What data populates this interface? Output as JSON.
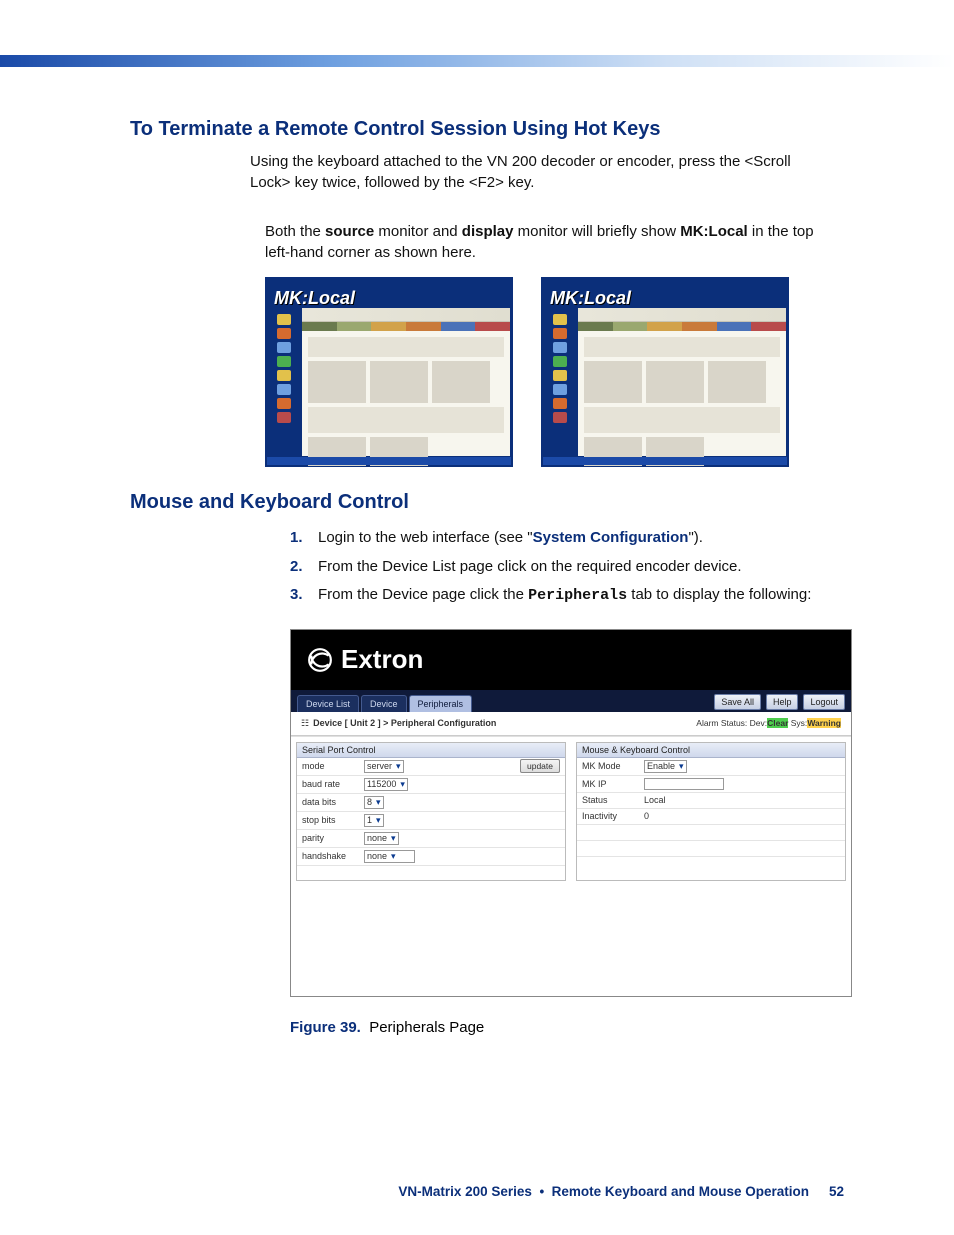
{
  "section1_title": "To Terminate a Remote Control Session Using Hot Keys",
  "section1_body": "Using the keyboard attached to the VN 200 decoder or encoder, press the <Scroll Lock> key twice, followed by the <F2> key.",
  "note_pre": "Both the ",
  "note_source": "source",
  "note_mid1": " monitor and ",
  "note_display": "display",
  "note_mid2": " monitor will briefly show ",
  "note_mklocal": "MK:Local",
  "note_post": " in the top left-hand corner as shown here.",
  "mk_overlay": "MK:Local",
  "section2_title": "Mouse and Keyboard Control",
  "steps": {
    "s1_pre": "Login to the web interface (see \"",
    "s1_link": "System Configuration",
    "s1_post": "\").",
    "s2": "From the Device List page click on the required encoder device.",
    "s3_pre": "From the Device page click the ",
    "s3_tt": "Peripherals",
    "s3_post": " tab to display the following:"
  },
  "app": {
    "brand": "Extron",
    "tabs": {
      "device_list": "Device List",
      "device": "Device",
      "peripherals": "Peripherals"
    },
    "buttons": {
      "save_all": "Save All",
      "help": "Help",
      "logout": "Logout",
      "update": "update"
    },
    "crumb": "Device [ Unit 2 ]  >  Peripheral Configuration",
    "alarm_label": "Alarm Status: Dev:",
    "alarm_dev": "Clear",
    "alarm_mid": "  Sys:",
    "alarm_sys": "Warning",
    "serial": {
      "title": "Serial Port Control",
      "rows": {
        "mode_l": "mode",
        "mode_v": "server",
        "baud_l": "baud rate",
        "baud_v": "115200",
        "data_l": "data bits",
        "data_v": "8",
        "stop_l": "stop bits",
        "stop_v": "1",
        "parity_l": "parity",
        "parity_v": "none",
        "hand_l": "handshake",
        "hand_v": "none"
      }
    },
    "mk": {
      "title": "Mouse & Keyboard Control",
      "rows": {
        "mode_l": "MK Mode",
        "mode_v": "Enable",
        "ip_l": "MK IP",
        "status_l": "Status",
        "status_v": "Local",
        "inact_l": "Inactivity",
        "inact_v": "0"
      }
    }
  },
  "figure_num": "Figure 39.",
  "figure_caption": "Peripherals Page",
  "footer_product": "VN-Matrix 200 Series",
  "footer_section": "Remote Keyboard and Mouse Operation",
  "footer_page": "52"
}
